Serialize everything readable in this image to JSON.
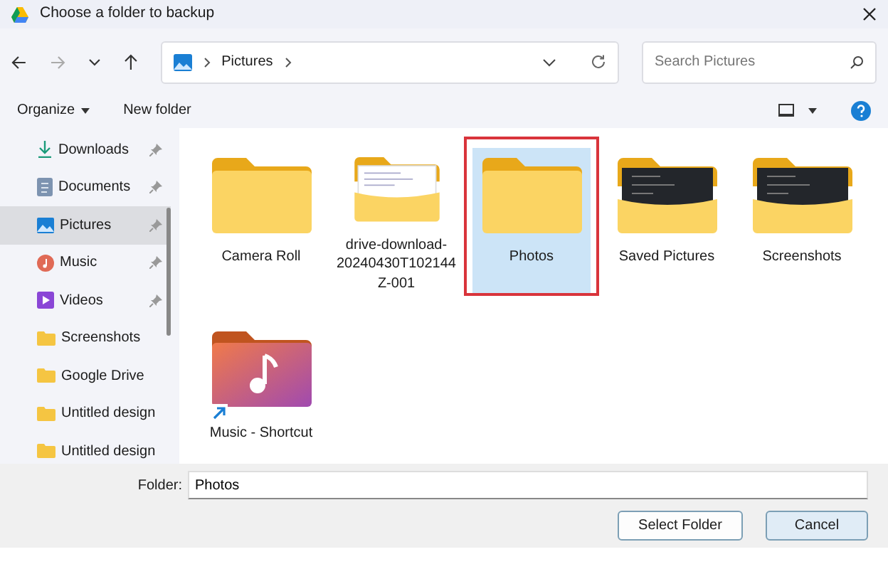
{
  "window": {
    "title": "Choose a folder to backup"
  },
  "address": {
    "path": [
      "Pictures"
    ]
  },
  "search": {
    "placeholder": "Search Pictures"
  },
  "toolbar": {
    "organize": "Organize",
    "new_folder": "New folder"
  },
  "sidebar": {
    "items": [
      {
        "label": "Downloads",
        "kind": "downloads",
        "pinned": true,
        "selected": false
      },
      {
        "label": "Documents",
        "kind": "documents",
        "pinned": true,
        "selected": false
      },
      {
        "label": "Pictures",
        "kind": "pictures",
        "pinned": true,
        "selected": true
      },
      {
        "label": "Music",
        "kind": "music",
        "pinned": true,
        "selected": false
      },
      {
        "label": "Videos",
        "kind": "videos",
        "pinned": true,
        "selected": false
      },
      {
        "label": "Screenshots",
        "kind": "folder",
        "pinned": false,
        "selected": false
      },
      {
        "label": "Google Drive",
        "kind": "folder",
        "pinned": false,
        "selected": false
      },
      {
        "label": "Untitled design",
        "kind": "folder",
        "pinned": false,
        "selected": false
      },
      {
        "label": "Untitled design",
        "kind": "folder",
        "pinned": false,
        "selected": false
      }
    ]
  },
  "folders": [
    {
      "name": "Camera Roll",
      "kind": "folder",
      "selected": false,
      "highlighted": false
    },
    {
      "name": "drive-download-20240430T102144Z-001",
      "kind": "document-preview",
      "selected": false,
      "highlighted": false
    },
    {
      "name": "Photos",
      "kind": "folder",
      "selected": true,
      "highlighted": true
    },
    {
      "name": "Saved Pictures",
      "kind": "dark-preview",
      "selected": false,
      "highlighted": false
    },
    {
      "name": "Screenshots",
      "kind": "dark-preview",
      "selected": false,
      "highlighted": false
    },
    {
      "name": "Music - Shortcut",
      "kind": "music-shortcut",
      "selected": false,
      "highlighted": false
    }
  ],
  "footer": {
    "folder_label": "Folder:",
    "folder_value": "Photos",
    "buttons": [
      {
        "label": "Select Folder",
        "kind": "primary"
      },
      {
        "label": "Cancel",
        "kind": "secondary"
      }
    ]
  }
}
